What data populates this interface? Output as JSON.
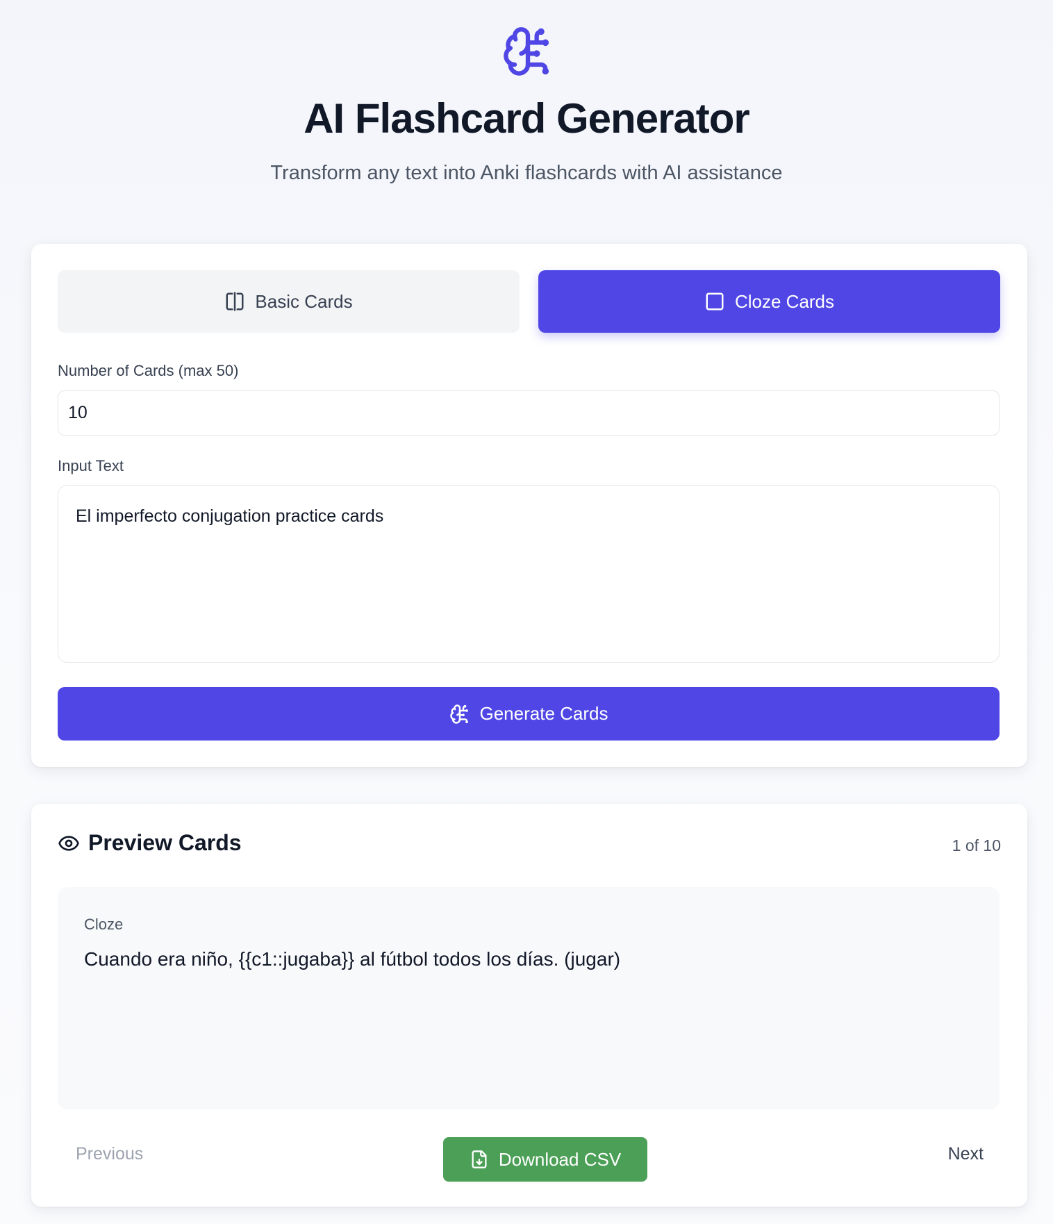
{
  "header": {
    "title": "AI Flashcard Generator",
    "subtitle": "Transform any text into Anki flashcards with AI assistance",
    "logo_icon": "brain-circuit-icon"
  },
  "modes": {
    "basic_label": "Basic Cards",
    "cloze_label": "Cloze Cards",
    "selected": "Cloze Cards"
  },
  "form": {
    "count_label": "Number of Cards (max 50)",
    "count_value": "10",
    "text_label": "Input Text",
    "text_value": "El imperfecto conjugation practice cards",
    "generate_label": "Generate Cards"
  },
  "preview": {
    "title": "Preview Cards",
    "counter": "1 of 10",
    "card_type": "Cloze",
    "card_text": "Cuando era niño, {{c1::jugaba}} al fútbol todos los días. (jugar)",
    "prev_label": "Previous",
    "next_label": "Next",
    "download_label": "Download CSV"
  },
  "colors": {
    "accent": "#4f46e5",
    "download": "#4c9f56",
    "background": "#f5f7fb"
  }
}
